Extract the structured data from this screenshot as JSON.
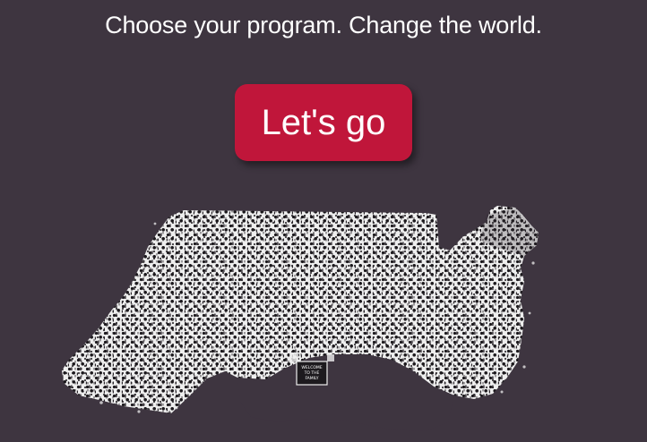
{
  "hero": {
    "tagline": "Choose your program. Change the world.",
    "cta_label": "Let's go"
  },
  "image": {
    "sign_line_1": "WELCOME",
    "sign_line_2": "TO THE",
    "sign_line_3": "FAMILY"
  },
  "colors": {
    "background": "#3e3540",
    "cta": "#c0163a",
    "text": "#ffffff"
  }
}
